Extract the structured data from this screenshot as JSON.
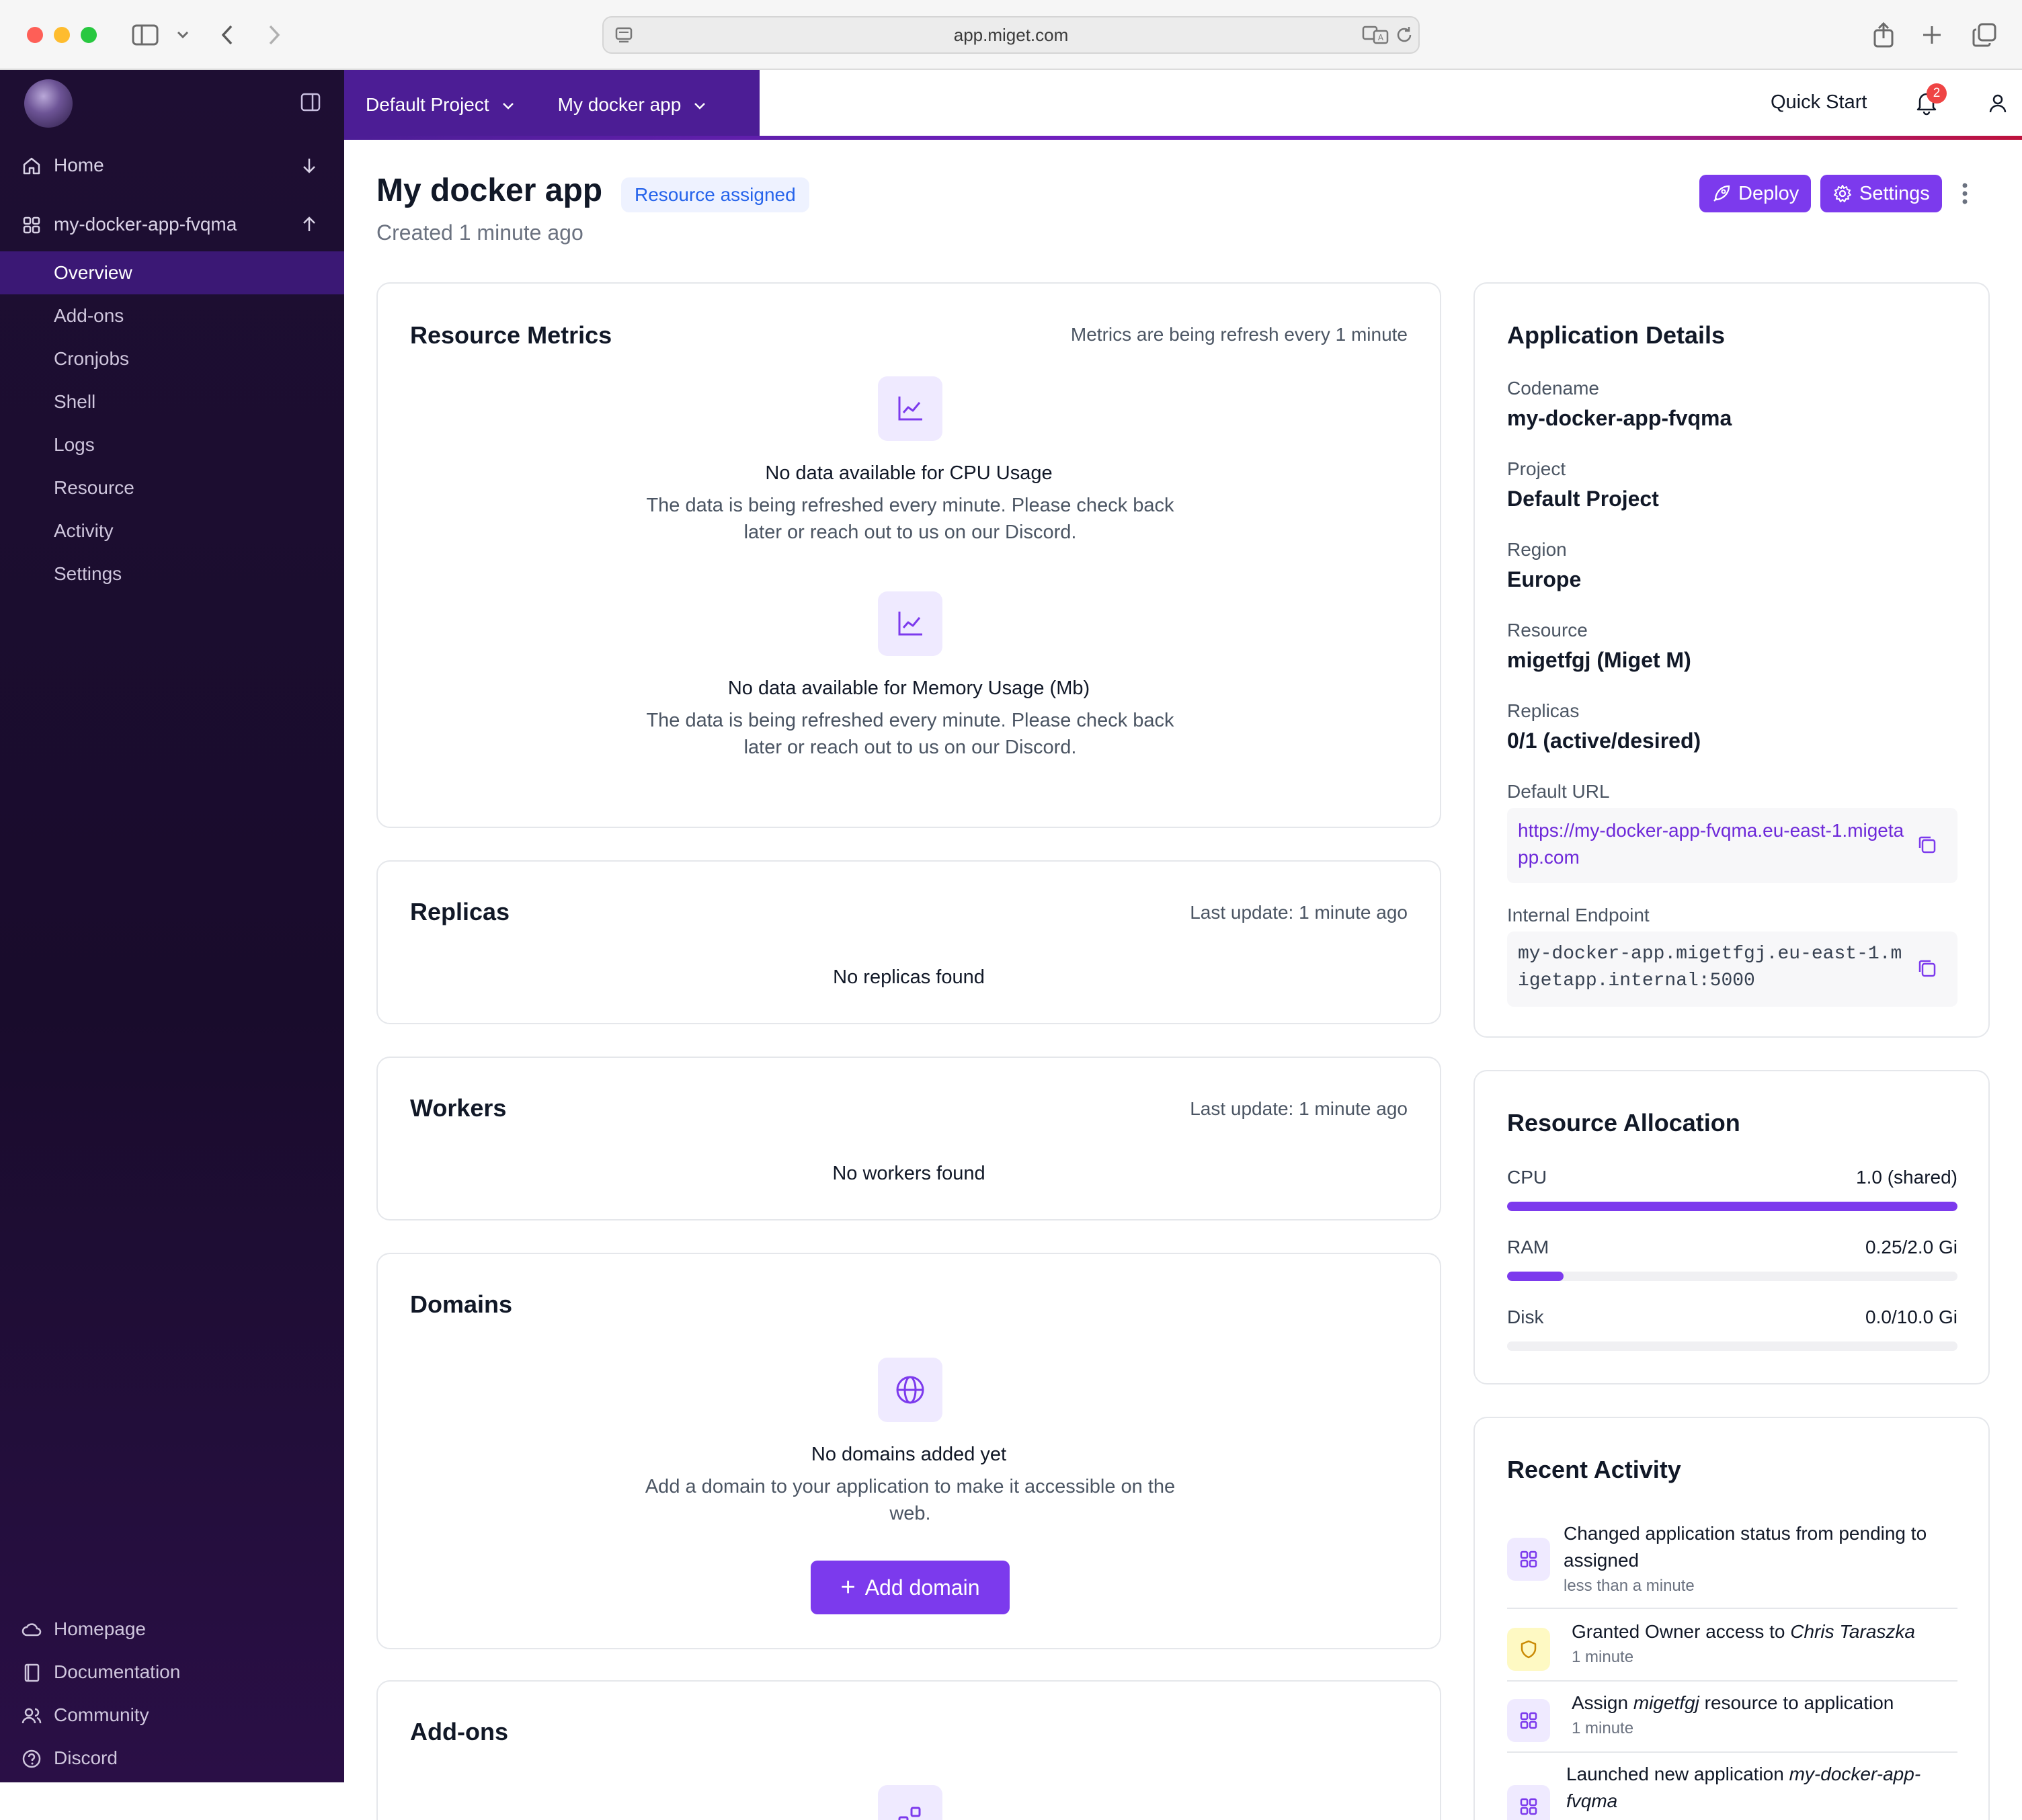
{
  "browser": {
    "url": "app.miget.com"
  },
  "sidebar": {
    "home_label": "Home",
    "app_label": "my-docker-app-fvqma",
    "items": [
      {
        "label": "Overview",
        "active": true
      },
      {
        "label": "Add-ons"
      },
      {
        "label": "Cronjobs"
      },
      {
        "label": "Shell"
      },
      {
        "label": "Logs"
      },
      {
        "label": "Resource"
      },
      {
        "label": "Activity"
      },
      {
        "label": "Settings"
      }
    ],
    "footer": [
      {
        "label": "Homepage",
        "icon": "cloud-icon"
      },
      {
        "label": "Documentation",
        "icon": "book-icon"
      },
      {
        "label": "Community",
        "icon": "users-icon"
      },
      {
        "label": "Discord",
        "icon": "help-circle-icon"
      }
    ]
  },
  "topbar": {
    "project": "Default Project",
    "app": "My docker app",
    "quick_start": "Quick Start",
    "notification_count": "2"
  },
  "header": {
    "title": "My docker app",
    "status": "Resource assigned",
    "created": "Created 1 minute ago",
    "deploy_label": "Deploy",
    "settings_label": "Settings"
  },
  "metrics": {
    "title": "Resource Metrics",
    "note": "Metrics are being refresh every 1 minute",
    "cpu_title": "No data available for CPU Usage",
    "cpu_desc": "The data is being refreshed every minute. Please check back later or reach out to us on our Discord.",
    "mem_title": "No data available for Memory Usage (Mb)",
    "mem_desc": "The data is being refreshed every minute. Please check back later or reach out to us on our Discord."
  },
  "replicas": {
    "title": "Replicas",
    "note": "Last update: 1 minute ago",
    "empty": "No replicas found"
  },
  "workers": {
    "title": "Workers",
    "note": "Last update: 1 minute ago",
    "empty": "No workers found"
  },
  "domains": {
    "title": "Domains",
    "empty_title": "No domains added yet",
    "empty_desc": "Add a domain to your application to make it accessible on the web.",
    "add_label": "Add domain"
  },
  "addons": {
    "title": "Add-ons"
  },
  "details": {
    "title": "Application Details",
    "codename_label": "Codename",
    "codename": "my-docker-app-fvqma",
    "project_label": "Project",
    "project": "Default Project",
    "region_label": "Region",
    "region": "Europe",
    "resource_label": "Resource",
    "resource": "migetfgj (Miget M)",
    "replicas_label": "Replicas",
    "replicas": "0/1 (active/desired)",
    "url_label": "Default URL",
    "url": "https://my-docker-app-fvqma.eu-east-1.migetapp.com",
    "endpoint_label": "Internal Endpoint",
    "endpoint": "my-docker-app.migetfgj.eu-east-1.migetapp.internal:5000"
  },
  "allocation": {
    "title": "Resource Allocation",
    "rows": [
      {
        "label": "CPU",
        "value": "1.0 (shared)",
        "fraction": 1.0
      },
      {
        "label": "RAM",
        "value": "0.25/2.0 Gi",
        "fraction": 0.125
      },
      {
        "label": "Disk",
        "value": "0.0/10.0 Gi",
        "fraction": 0.0
      }
    ]
  },
  "activity": {
    "title": "Recent Activity",
    "items": [
      {
        "text": "Changed application status from pending to assigned",
        "time": "less than a minute",
        "icon": "grid-icon"
      },
      {
        "text_before": "Granted Owner access to ",
        "text_em": "Chris Taraszka",
        "text_after": "",
        "time": "1 minute",
        "icon": "shield-icon"
      },
      {
        "text_before": "Assign ",
        "text_em": "migetfgj",
        "text_after": " resource to application",
        "time": "1 minute",
        "icon": "grid-icon"
      },
      {
        "text_before": "Launched new application ",
        "text_em": "my-docker-app-fvqma",
        "text_after": "",
        "time": "",
        "icon": "grid-icon"
      }
    ]
  },
  "colors": {
    "accent": "#7c3aed",
    "sidebar": "#1e0e33",
    "breadcrumb": "#4c1d95",
    "badge": "#ef4444"
  }
}
